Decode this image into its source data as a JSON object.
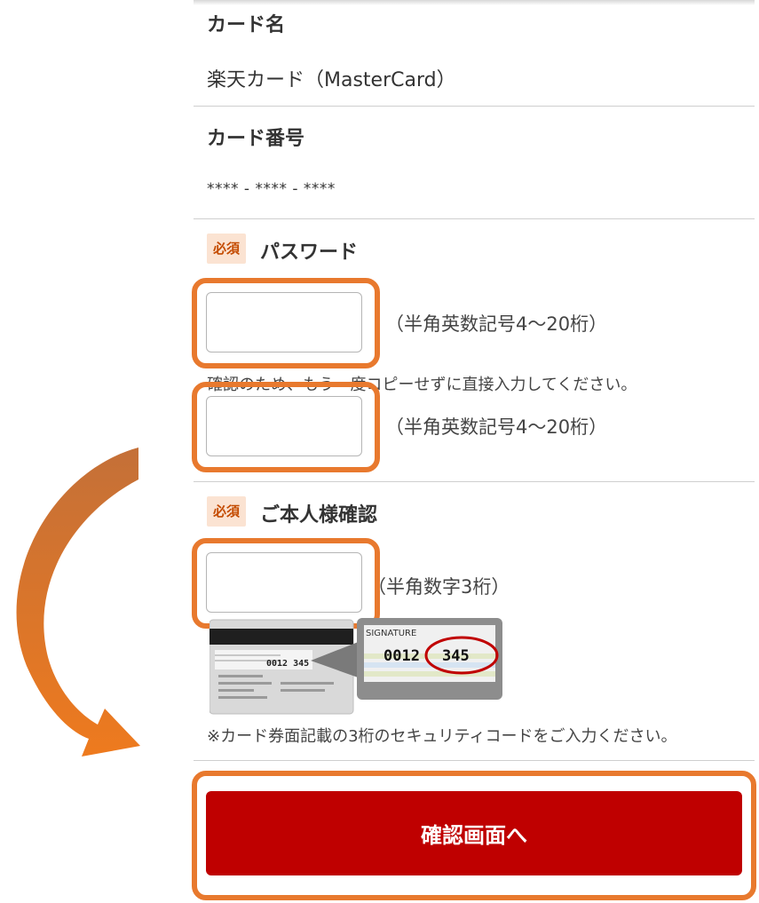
{
  "card_name": {
    "label": "カード名",
    "value": "楽天カード（MasterCard）"
  },
  "card_number": {
    "label": "カード番号",
    "value": "**** - **** - ****"
  },
  "password": {
    "badge": "必須",
    "label": "パスワード",
    "hint": "（半角英数記号4〜20桁）",
    "confirm_note": "確認のため、もう一度コピーせずに直接入力してください。",
    "confirm_hint": "（半角英数記号4〜20桁）"
  },
  "identity": {
    "badge": "必須",
    "label": "ご本人様確認",
    "hint": "（半角数字3桁）",
    "card_signature_label": "SIGNATURE",
    "card_code_left": "0012",
    "card_code_right": "345",
    "card_back_code": "0012 345",
    "note": "※カード券面記載の3桁のセキュリティコードをご入力ください。"
  },
  "submit": {
    "label": "確認画面へ"
  },
  "colors": {
    "highlight": "#e8792e",
    "button": "#bf0000",
    "badge_bg": "#fbe3d2",
    "badge_text": "#c44b00"
  }
}
